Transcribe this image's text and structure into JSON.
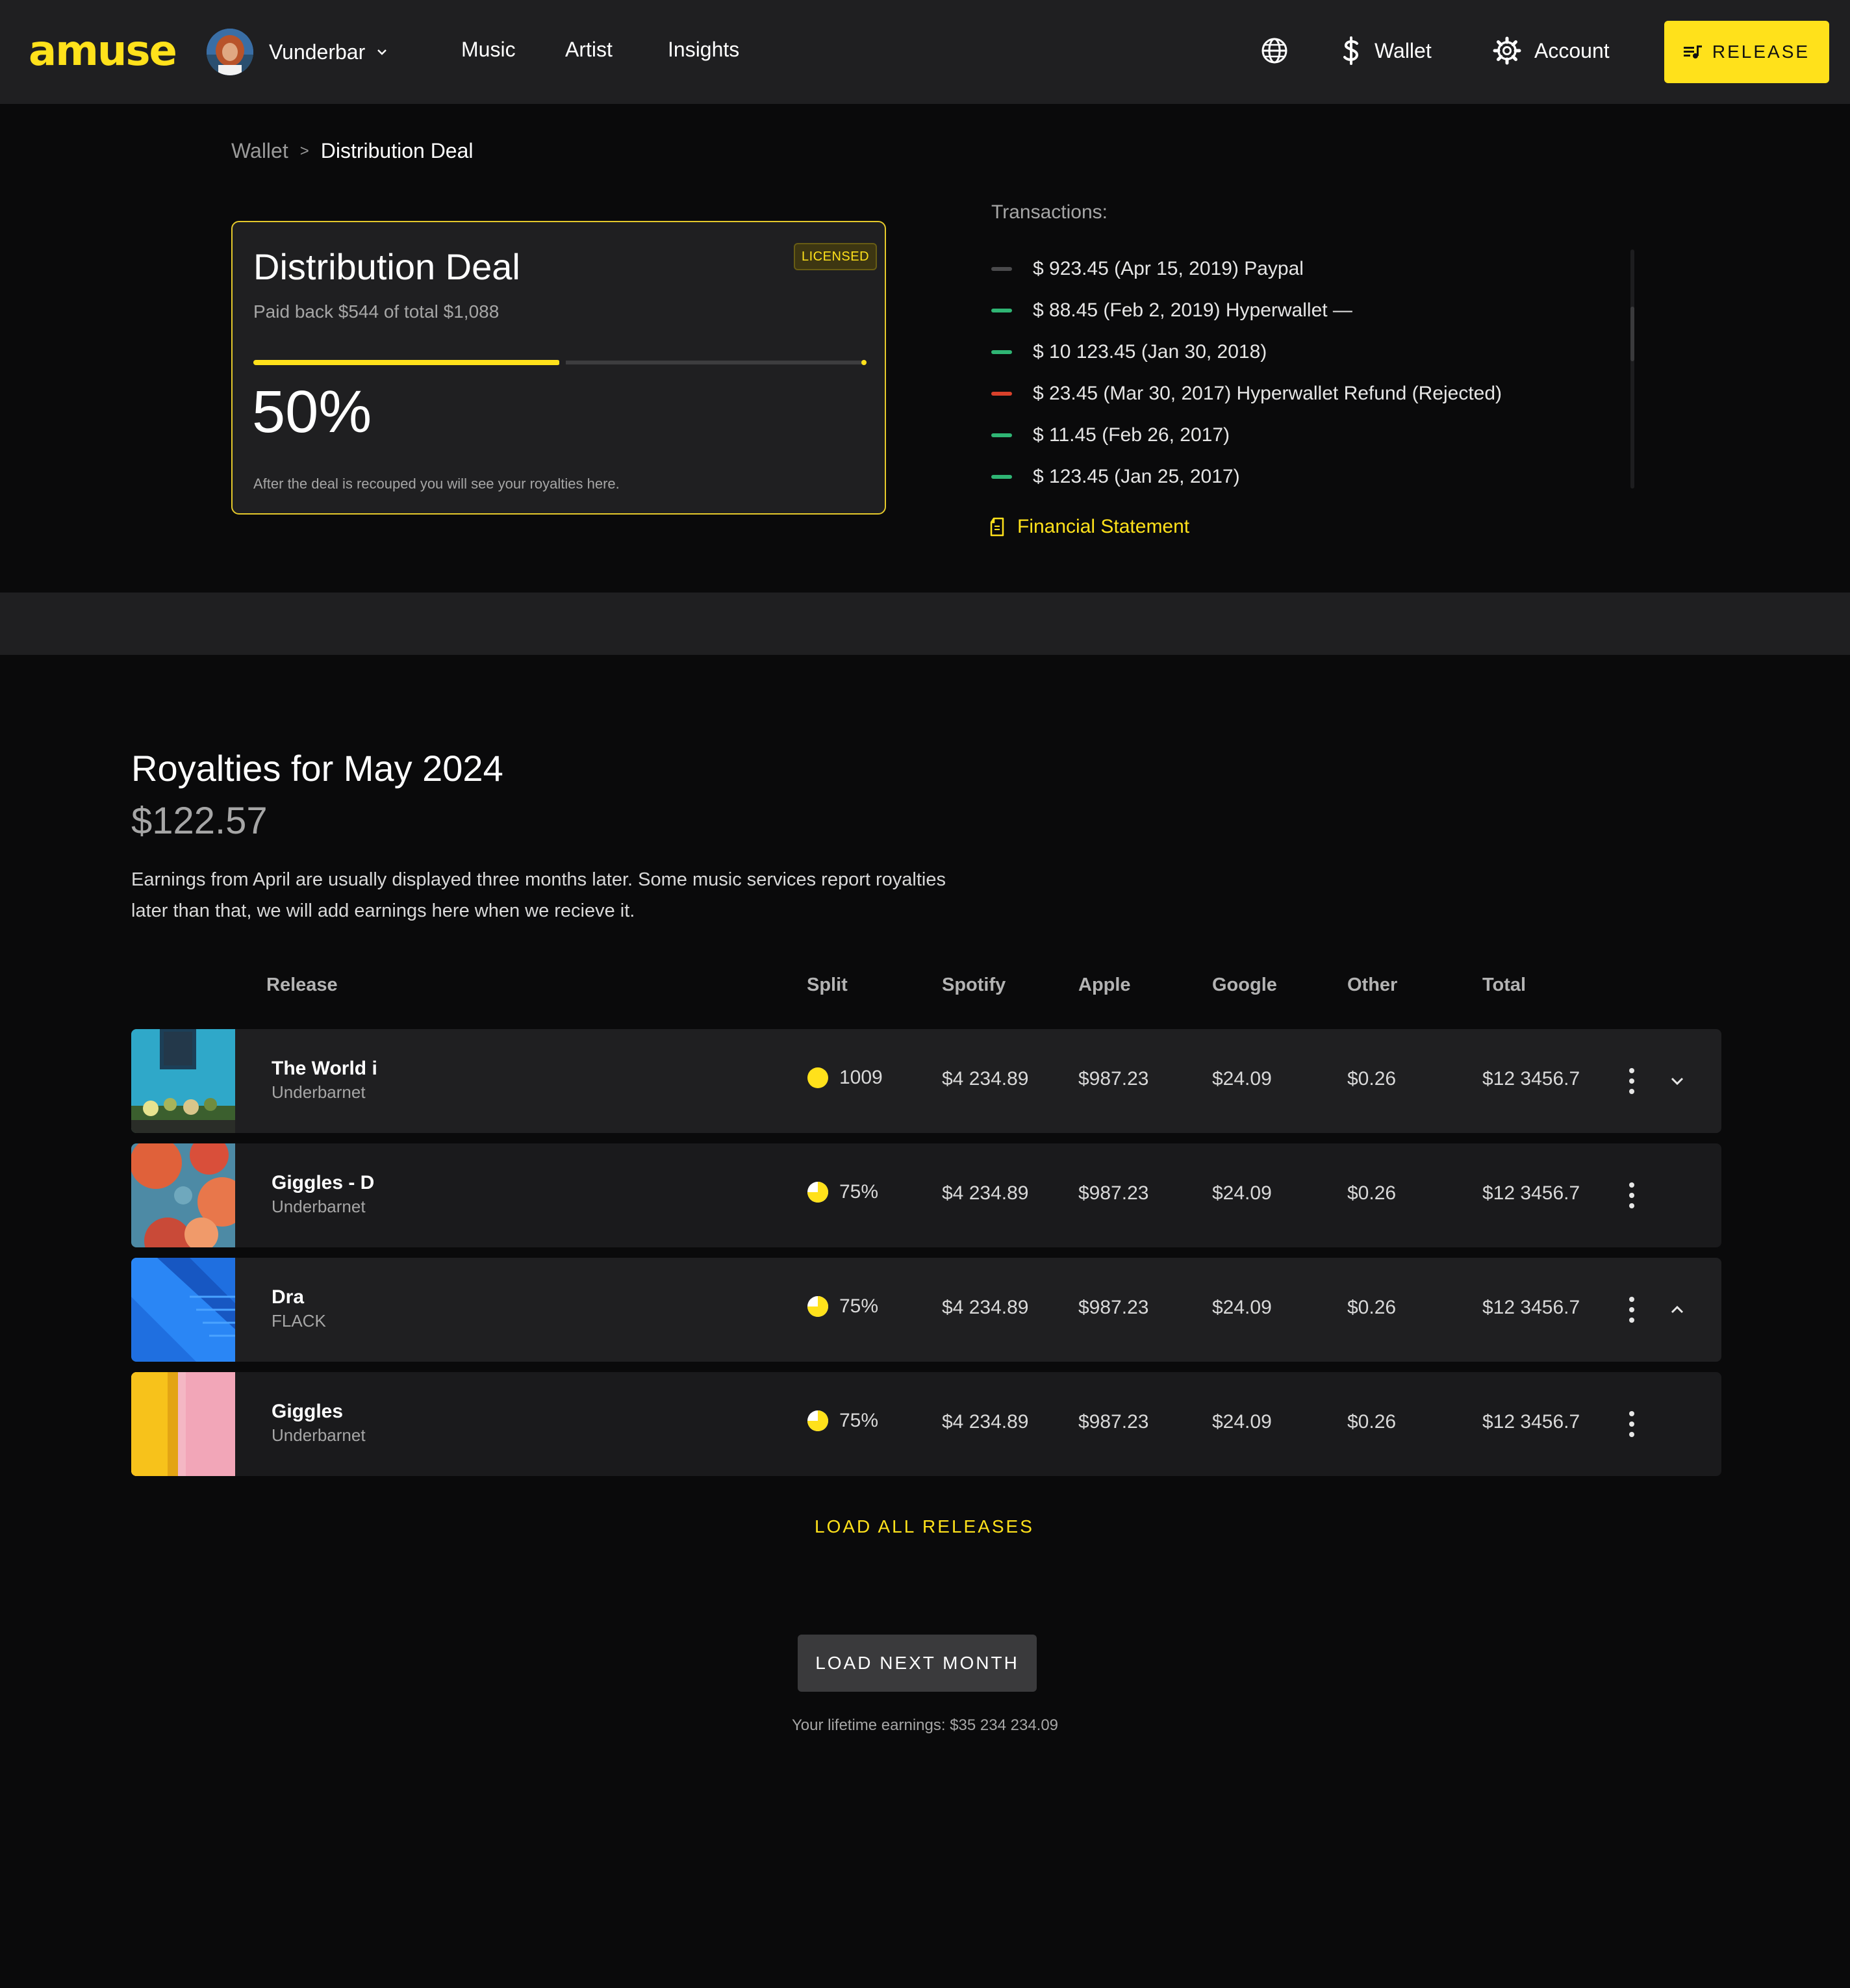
{
  "header": {
    "logo": "amuse",
    "user_name": "Vunderbar",
    "nav": [
      "Music",
      "Artist",
      "Insights"
    ],
    "wallet_label": "Wallet",
    "account_label": "Account",
    "release_label": "RELEASE",
    "accent": "#ffe11b"
  },
  "breadcrumb": {
    "parent": "Wallet",
    "separator": ">",
    "current": "Distribution Deal"
  },
  "deal": {
    "title": "Distribution Deal",
    "badge": "LICENSED",
    "subtitle": "Paid back $544 of total $1,088",
    "progress_fraction": 0.5,
    "percent_label": "50%",
    "note": "After the deal is recouped you will see your royalties here."
  },
  "transactions": {
    "label": "Transactions:",
    "items": [
      {
        "text": "$ 923.45 (Apr 15, 2019) Paypal",
        "status_color": "#4a4a4c"
      },
      {
        "text": "$ 88.45 (Feb 2, 2019) Hyperwallet —",
        "status_color": "#2fb574"
      },
      {
        "text": "$ 10 123.45 (Jan 30, 2018)",
        "status_color": "#2fb574"
      },
      {
        "text": "$ 23.45 (Mar 30, 2017) Hyperwallet Refund (Rejected)",
        "status_color": "#d9412b"
      },
      {
        "text": "$ 11.45 (Feb 26, 2017)",
        "status_color": "#2fb574"
      },
      {
        "text": "$ 123.45 (Jan 25, 2017)",
        "status_color": "#2fb574"
      }
    ],
    "statement_label": "Financial Statement"
  },
  "royalties": {
    "title": "Royalties for May 2024",
    "amount": "$122.57",
    "description": "Earnings from April are usually displayed three months later. Some music services report royalties later than that, we will add earnings here when we recieve it.",
    "columns": [
      "Release",
      "Split",
      "Spotify",
      "Apple",
      "Google",
      "Other",
      "Total"
    ],
    "rows": [
      {
        "title": "The World i",
        "artist": "Underbarnet",
        "split": "1009",
        "split_fraction": 1.0,
        "spotify": "$4 234.89",
        "apple": "$987.23",
        "google": "$24.09",
        "other": "$0.26",
        "total": "$12 3456.7",
        "expand": "chevron-down"
      },
      {
        "title": "Giggles - D",
        "artist": "Underbarnet",
        "split": "75%",
        "split_fraction": 0.75,
        "spotify": "$4 234.89",
        "apple": "$987.23",
        "google": "$24.09",
        "other": "$0.26",
        "total": "$12 3456.7",
        "expand": ""
      },
      {
        "title": "Dra",
        "artist": "FLACK",
        "split": "75%",
        "split_fraction": 0.75,
        "spotify": "$4 234.89",
        "apple": "$987.23",
        "google": "$24.09",
        "other": "$0.26",
        "total": "$12 3456.7",
        "expand": "chevron-up"
      },
      {
        "title": "Giggles",
        "artist": "Underbarnet",
        "split": "75%",
        "split_fraction": 0.75,
        "spotify": "$4 234.89",
        "apple": "$987.23",
        "google": "$24.09",
        "other": "$0.26",
        "total": "$12 3456.7",
        "expand": ""
      }
    ],
    "load_all_label": "LOAD ALL RELEASES",
    "load_next_label": "LOAD NEXT MONTH",
    "lifetime": "Your lifetime earnings: $35 234 234.09"
  }
}
